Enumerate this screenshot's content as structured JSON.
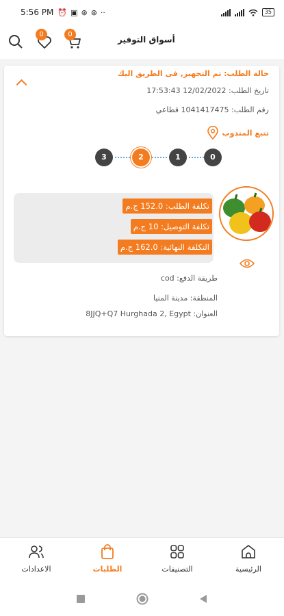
{
  "status_bar": {
    "time": "5:56 PM",
    "notification_icons": [
      "⏰",
      "▣",
      "⊛",
      "⊛",
      "··"
    ],
    "battery": "35"
  },
  "header": {
    "title": "أسواق التوفير",
    "favorites_count": "0",
    "cart_count": "0"
  },
  "order": {
    "status": "حالة الطلب: تم التجهيز, فى الطريق اليك",
    "date": "تاريخ الطلب:  12/02/2022 17:53:43",
    "order_number": "رقم الطلب: 1041417475 قطاعي",
    "track_label": "تتبع المندوب",
    "steps": [
      "3",
      "2",
      "1",
      "0"
    ],
    "active_step": "2",
    "costs": {
      "order_cost": "تكلفة الطلب: 152.0 ج.م",
      "delivery_cost": "تكلفة التوصيل: 10 ج.م",
      "total_cost": "التكلفة النهائية: 162.0 ج.م"
    },
    "payment_method": "طريقة الدفع: cod",
    "region": "المنطقة: مدينة المنيا",
    "address": "العنوان: 8JJQ+Q7 Hurghada 2, Egypt"
  },
  "bottom_nav": {
    "settings": "الاعدادات",
    "orders": "الطلبات",
    "categories": "التصنيفات",
    "home": "الرئيسية"
  },
  "colors": {
    "accent": "#f47c20",
    "step_inactive": "#444444",
    "cost_box": "#ececec"
  }
}
